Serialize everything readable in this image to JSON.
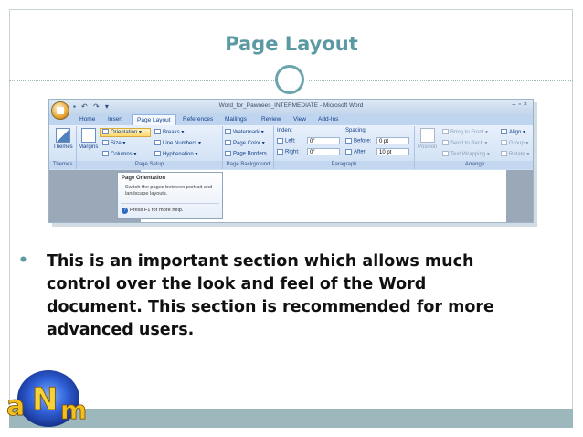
{
  "slide": {
    "title": "Page Layout",
    "bullet": "This is an important section which allows much control over the look and feel of the Word document. This section is recommended for more advanced users."
  },
  "logo": {
    "text": "aNm"
  },
  "word": {
    "window_title": "Word_for_Pawnees_INTERMEDIATE - Microsoft Word",
    "tabs": [
      "Home",
      "Insert",
      "Page Layout",
      "References",
      "Mailings",
      "Review",
      "View",
      "Add-Ins"
    ],
    "active_tab": "Page Layout",
    "groups": {
      "themes": {
        "label": "Themes",
        "button": "Themes"
      },
      "page_setup": {
        "label": "Page Setup",
        "margins": "Margins",
        "orientation": "Orientation",
        "size": "Size",
        "columns": "Columns",
        "breaks": "Breaks",
        "line_numbers": "Line Numbers",
        "hyphenation": "Hyphenation"
      },
      "page_background": {
        "label": "Page Background",
        "watermark": "Watermark",
        "page_color": "Page Color",
        "page_borders": "Page Borders"
      },
      "paragraph": {
        "label": "Paragraph",
        "indent": "Indent",
        "left_label": "Left:",
        "left_value": "0\"",
        "right_label": "Right:",
        "right_value": "0\"",
        "spacing": "Spacing",
        "before_label": "Before:",
        "before_value": "0 pt",
        "after_label": "After:",
        "after_value": "10 pt"
      },
      "arrange": {
        "label": "Arrange",
        "position": "Position",
        "bring_to_front": "Bring to Front",
        "send_to_back": "Send to Back",
        "text_wrapping": "Text Wrapping",
        "align": "Align",
        "group": "Group",
        "rotate": "Rotate"
      }
    },
    "tooltip": {
      "title": "Page Orientation",
      "description": "Switch the pages between portrait and landscape layouts.",
      "help": "Press F1 for more help."
    }
  },
  "colors": {
    "accent": "#5b9aa2",
    "footer": "#9cb8bc",
    "ribbon_text": "#15428b"
  }
}
